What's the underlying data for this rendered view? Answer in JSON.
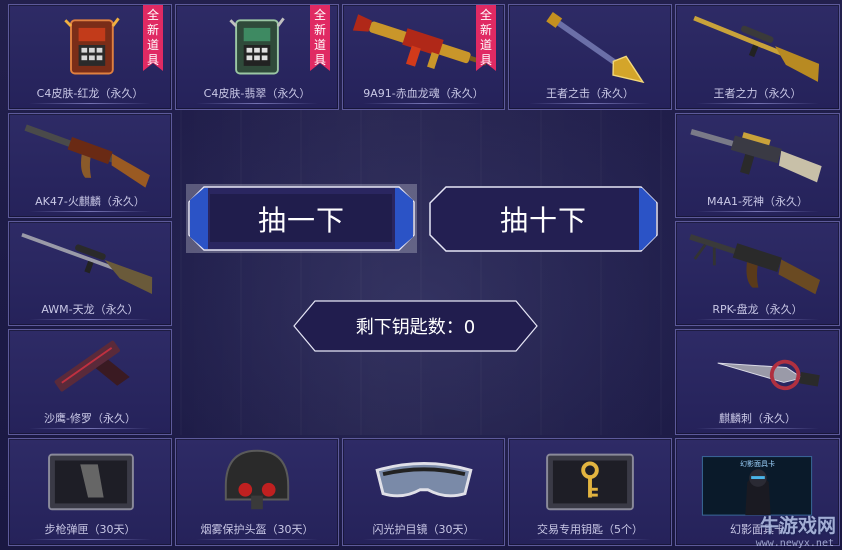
{
  "items": [
    {
      "id": "c4-red",
      "label": "C4皮肤-红龙（永久）",
      "badge": [
        "全",
        "新",
        "道",
        "具"
      ],
      "icon": "c4-bomb-red-icon"
    },
    {
      "id": "c4-jade",
      "label": "C4皮肤-翡翠（永久）",
      "badge": [
        "全",
        "新",
        "道",
        "具"
      ],
      "icon": "c4-bomb-jade-icon"
    },
    {
      "id": "9a91",
      "label": "9A91-赤血龙魂（永久）",
      "badge": [
        "全",
        "新",
        "道",
        "具"
      ],
      "icon": "rifle-gold-red-icon"
    },
    {
      "id": "shovel",
      "label": "王者之击（永久）",
      "icon": "golden-shovel-icon"
    },
    {
      "id": "awp-king",
      "label": "王者之力（永久）",
      "icon": "sniper-gold-icon"
    },
    {
      "id": "ak47",
      "label": "AK47-火麒麟（永久）",
      "icon": "ak47-icon"
    },
    {
      "id": "m4a1",
      "label": "M4A1-死神（永久）",
      "icon": "m4a1-icon"
    },
    {
      "id": "awm",
      "label": "AWM-天龙（永久）",
      "icon": "awm-sniper-icon"
    },
    {
      "id": "rpk",
      "label": "RPK-盘龙（永久）",
      "icon": "rpk-machinegun-icon"
    },
    {
      "id": "deagle",
      "label": "沙鹰-修罗（永久）",
      "icon": "desert-eagle-icon"
    },
    {
      "id": "qilin-blade",
      "label": "麒麟刺（永久）",
      "icon": "qilin-blade-icon"
    },
    {
      "id": "magazine",
      "label": "步枪弹匣（30天）",
      "icon": "rifle-magazine-icon"
    },
    {
      "id": "helmet",
      "label": "烟雾保护头盔（30天）",
      "icon": "gas-helmet-icon"
    },
    {
      "id": "goggles",
      "label": "闪光护目镜（30天）",
      "icon": "goggles-icon"
    },
    {
      "id": "trade-key",
      "label": "交易专用钥匙（5个）",
      "icon": "golden-key-icon"
    },
    {
      "id": "card",
      "label": "幻影面具卡",
      "card_title": "幻影面具卡",
      "icon": "mask-card-icon"
    }
  ],
  "buttons": {
    "draw_one": "抽一下",
    "draw_ten": "抽十下"
  },
  "key_count": {
    "label": "剩下钥匙数：0",
    "value": 0
  },
  "watermark": {
    "text": "牛游戏网",
    "url": "www.newyx.net"
  },
  "colors": {
    "cell_bg": "#2a275f",
    "border": "#5d5a9a",
    "accent_blue": "#2b53c6",
    "badge": "#e02a63"
  }
}
